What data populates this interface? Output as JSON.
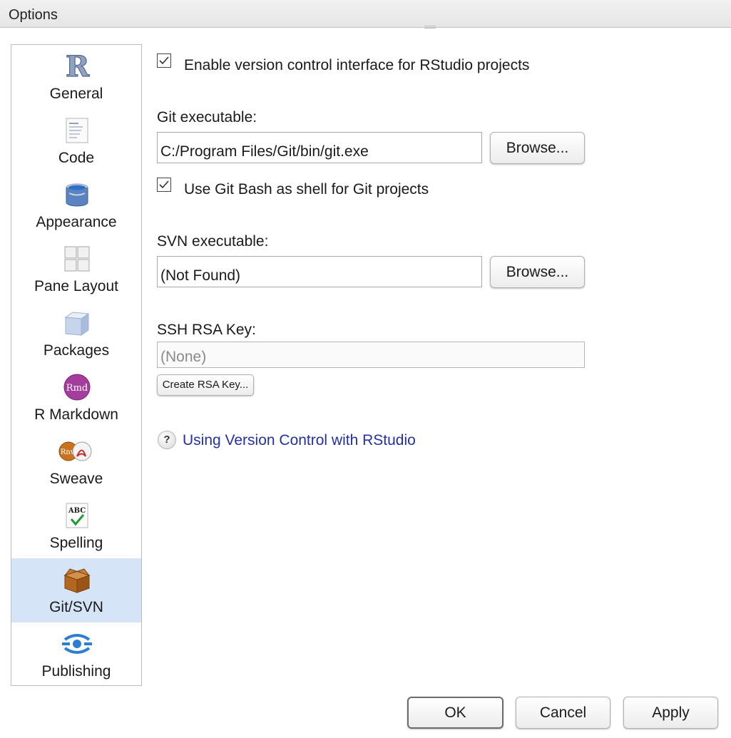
{
  "window": {
    "title": "Options"
  },
  "sidebar": {
    "items": [
      {
        "label": "General",
        "icon": "r-logo-icon"
      },
      {
        "label": "Code",
        "icon": "code-document-icon"
      },
      {
        "label": "Appearance",
        "icon": "paint-bucket-icon"
      },
      {
        "label": "Pane Layout",
        "icon": "pane-grid-icon"
      },
      {
        "label": "Packages",
        "icon": "package-box-icon"
      },
      {
        "label": "R Markdown",
        "icon": "rmd-icon"
      },
      {
        "label": "Sweave",
        "icon": "sweave-icon"
      },
      {
        "label": "Spelling",
        "icon": "spelling-abc-icon"
      },
      {
        "label": "Git/SVN",
        "icon": "cardboard-box-icon",
        "selected": true
      },
      {
        "label": "Publishing",
        "icon": "publishing-icon"
      }
    ]
  },
  "git_svn": {
    "enable_vcs": {
      "label": "Enable version control interface for RStudio projects",
      "checked": true
    },
    "git_executable": {
      "label": "Git executable:",
      "value": "C:/Program Files/Git/bin/git.exe",
      "browse_label": "Browse..."
    },
    "git_bash": {
      "label": "Use Git Bash as shell for Git projects",
      "checked": true
    },
    "svn_executable": {
      "label": "SVN executable:",
      "value": "(Not Found)",
      "browse_label": "Browse..."
    },
    "ssh_rsa": {
      "label": "SSH RSA Key:",
      "value": "(None)",
      "create_label": "Create RSA Key..."
    },
    "help_link": {
      "icon_glyph": "?",
      "label": "Using Version Control with RStudio"
    }
  },
  "footer": {
    "ok_label": "OK",
    "cancel_label": "Cancel",
    "apply_label": "Apply"
  },
  "colors": {
    "selected_bg": "#d5e5f7",
    "link": "#2330a8"
  }
}
